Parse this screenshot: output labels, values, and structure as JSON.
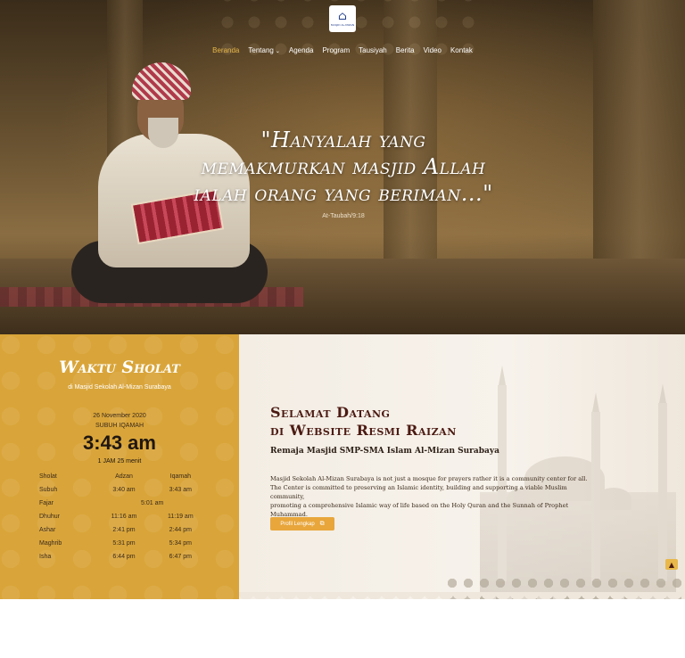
{
  "header": {
    "logo_text": "MASJID AL-MIZAN",
    "nav": [
      {
        "label": "Beranda",
        "active": true
      },
      {
        "label": "Tentang",
        "has_dropdown": true
      },
      {
        "label": "Agenda"
      },
      {
        "label": "Program"
      },
      {
        "label": "Tausiyah"
      },
      {
        "label": "Berita"
      },
      {
        "label": "Video"
      },
      {
        "label": "Kontak"
      }
    ],
    "caret_icon": "chevron-down-icon"
  },
  "hero": {
    "quote_line1": "\"Hanyalah yang",
    "quote_line2": "memakmurkan masjid Allah",
    "quote_line3": "ialah orang yang beriman...\"",
    "source": "At-Taubah/9:18"
  },
  "prayer": {
    "title": "Waktu Sholat",
    "subtitle": "di Masjid Sekolah Al-Mizan Surabaya",
    "date": "26 November 2020",
    "next_label": "SUBUH IQAMAH",
    "clock": "3:43 am",
    "countdown": "1 JAM 25 menit",
    "columns": [
      "Sholat",
      "Adzan",
      "Iqamah"
    ],
    "rows": [
      {
        "name": "Subuh",
        "adzan": "3:40 am",
        "iqamah": "3:43 am"
      },
      {
        "name": "Fajar",
        "single": "5:01 am"
      },
      {
        "name": "Dhuhur",
        "adzan": "11:16 am",
        "iqamah": "11:19 am"
      },
      {
        "name": "Ashar",
        "adzan": "2:41 pm",
        "iqamah": "2:44 pm"
      },
      {
        "name": "Maghrib",
        "adzan": "5:31 pm",
        "iqamah": "5:34 pm"
      },
      {
        "name": "Isha",
        "adzan": "6:44 pm",
        "iqamah": "6:47 pm"
      }
    ]
  },
  "welcome": {
    "title_line1": "Selamat Datang",
    "title_line2": "di Website Resmi Raizan",
    "subtitle": "Remaja Masjid SMP-SMA Islam Al-Mizan Surabaya",
    "text_line1": "Masjid Sekolah Al-Mizan Surabaya is not just a mosque for prayers rather it is a community center for all.",
    "text_line2": "The Center is committed to preserving an Islamic identity, building and supporting a viable Muslim community,",
    "text_line3": "promoting a comprehensive Islamic way of life based on the Holy Quran and the Sunnah of Prophet Muhammad.",
    "button_label": "Profil Lengkap",
    "button_icon": "external-link-icon"
  },
  "scroll_top_icon": "arrow-up-icon",
  "colors": {
    "gold": "#d9a53a",
    "button": "#e8a63b",
    "title_brown": "#4b1a12",
    "nav_active": "#e8b84a"
  }
}
